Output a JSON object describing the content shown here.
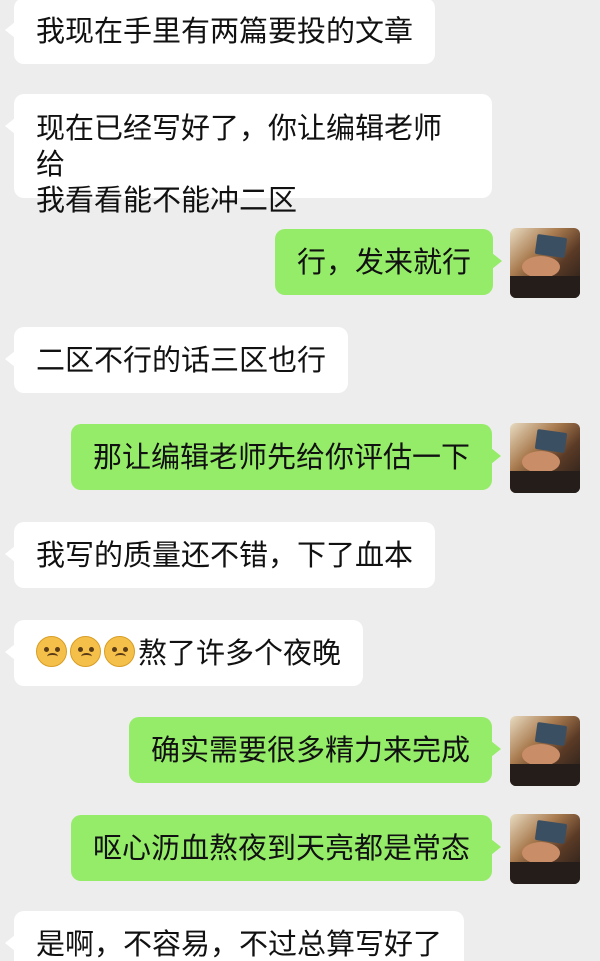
{
  "messages": [
    {
      "side": "left",
      "text": "我现在手里有两篇要投的文章"
    },
    {
      "side": "left",
      "text_line1": "现在已经写好了，你让编辑老师给",
      "text_line2": "我看看能不能冲二区"
    },
    {
      "side": "right",
      "text": "行，发来就行"
    },
    {
      "side": "left",
      "text": "二区不行的话三区也行"
    },
    {
      "side": "right",
      "text": "那让编辑老师先给你评估一下"
    },
    {
      "side": "left",
      "text": "我写的质量还不错，下了血本"
    },
    {
      "side": "left",
      "emoji": "crying-face-icon",
      "text": "熬了许多个夜晚"
    },
    {
      "side": "right",
      "text": "确实需要很多精力来完成"
    },
    {
      "side": "right",
      "text": "呕心沥血熬夜到天亮都是常态"
    },
    {
      "side": "left",
      "text": "是啊，不容易，不过总算写好了"
    }
  ],
  "colors": {
    "background": "#ededed",
    "incoming_bubble": "#ffffff",
    "outgoing_bubble": "#95ec69"
  }
}
